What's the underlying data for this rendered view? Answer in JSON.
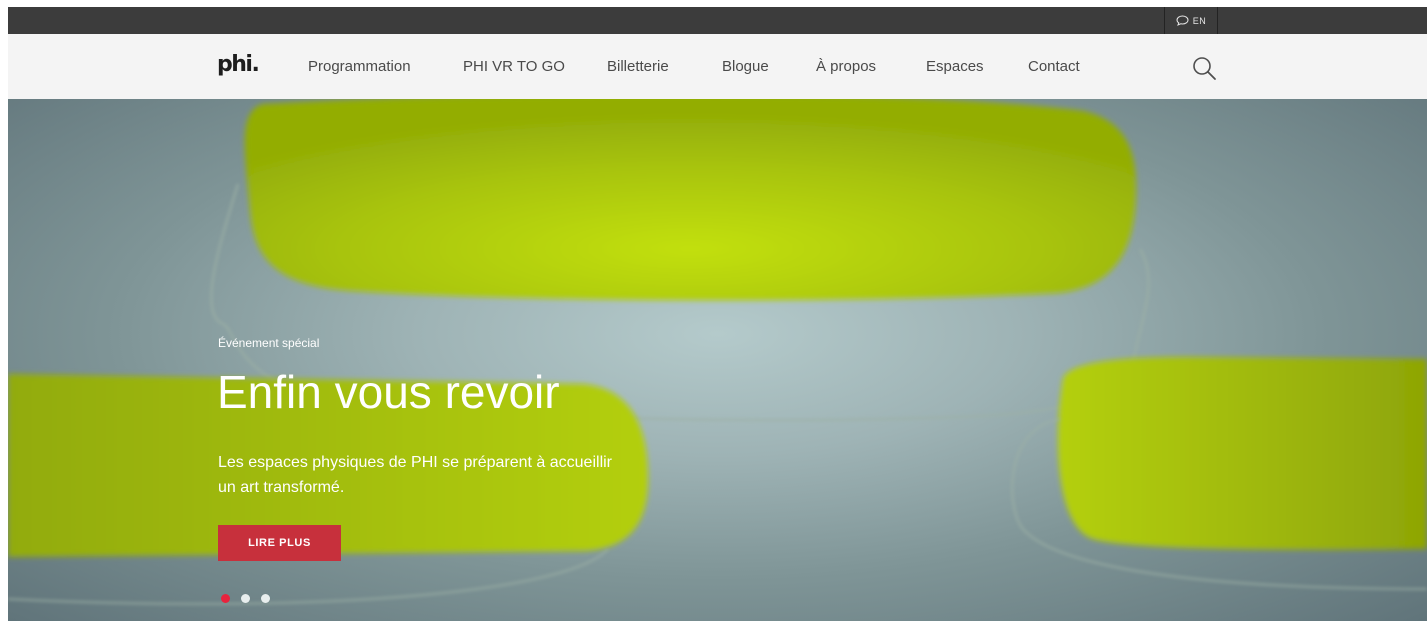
{
  "top_bar": {
    "language_label": "EN",
    "language_icon": "speech-bubble-icon"
  },
  "nav": {
    "logo": "phi.",
    "items": [
      {
        "label": "Programmation"
      },
      {
        "label": "PHI VR TO GO"
      },
      {
        "label": "Billetterie"
      },
      {
        "label": "Blogue"
      },
      {
        "label": "À propos"
      },
      {
        "label": "Espaces"
      },
      {
        "label": "Contact"
      }
    ],
    "search_icon": "search-icon"
  },
  "hero": {
    "eyebrow": "Événement spécial",
    "title": "Enfin vous revoir",
    "description": "Les espaces physiques de PHI se préparent à accueillir un art transformé.",
    "cta_label": "LIRE PLUS",
    "slides": 3,
    "active_slide": 1
  },
  "colors": {
    "top_bar": "#3c3c3c",
    "nav_background": "#f4f4f4",
    "accent_button": "#c7303c",
    "active_dot": "#e8233d",
    "art_green": "#b9d60c"
  }
}
